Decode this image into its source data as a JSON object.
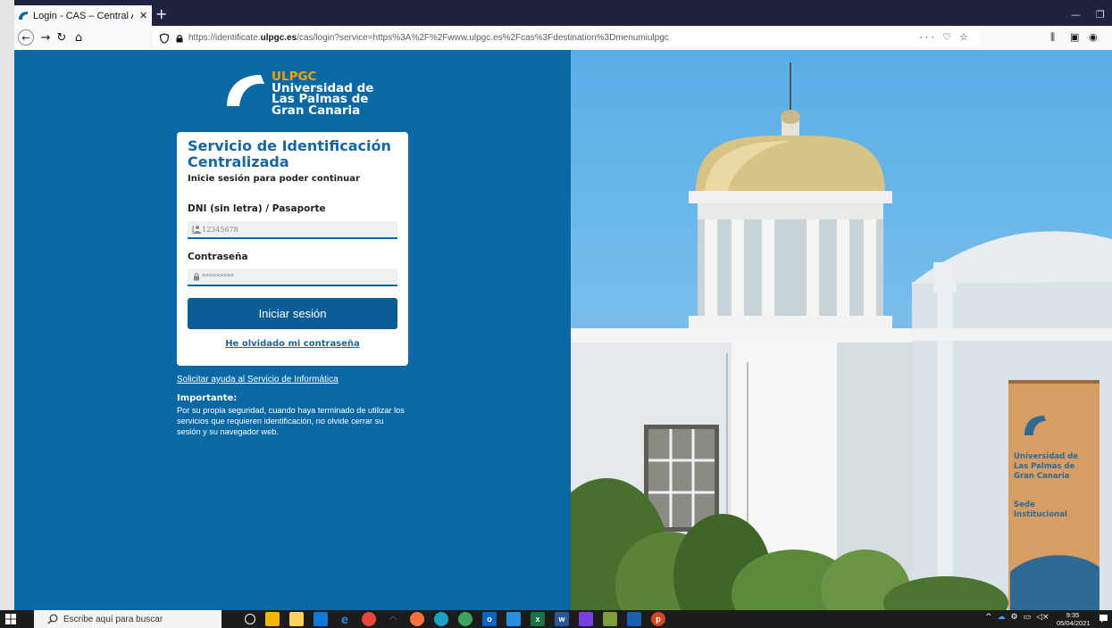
{
  "browser": {
    "tab_title": "Login - CAS – Central Authenti",
    "new_tab_symbol": "+",
    "url_prefix": "https://identificate.",
    "url_domain": "ulpgc.es",
    "url_suffix": "/cas/login?service=https%3A%2F%2Fwww.ulpgc.es%2Fcas%3Fdestination%3Dmenumiulpgc",
    "url_more": "···"
  },
  "logo": {
    "brand": "ULPGC",
    "line1": "Universidad de",
    "line2": "Las Palmas de",
    "line3": "Gran Canaria"
  },
  "login": {
    "title": "Servicio de Identificación Centralizada",
    "subtitle": "Inicie sesión para poder continuar",
    "username_label": "DNI (sin letra) / Pasaporte",
    "username_placeholder": "12345678",
    "password_label": "Contraseña",
    "password_placeholder": "*********",
    "submit_label": "Iniciar sesión",
    "forgot_label": "He olvidado mi contraseña"
  },
  "info": {
    "help_link": "Solicitar ayuda al Servicio de Informática",
    "important_title": "Importante:",
    "important_text": "Por su propia seguridad, cuando haya terminado de utilizar los servicios que requieren identificación, no olvide cerrar su sesión y su navegador web."
  },
  "banner": {
    "line1": "Universidad de",
    "line2": "Las Palmas de",
    "line3": "Gran Canaria",
    "line4": "Sede",
    "line5": "Institucional"
  },
  "taskbar": {
    "search_placeholder": "Escribe aquí para buscar",
    "time": "9:35",
    "date": "05/04/2021"
  },
  "colors": {
    "brand_blue": "#0a68a5",
    "brand_orange": "#f5a300",
    "browser_dark": "#202340"
  }
}
